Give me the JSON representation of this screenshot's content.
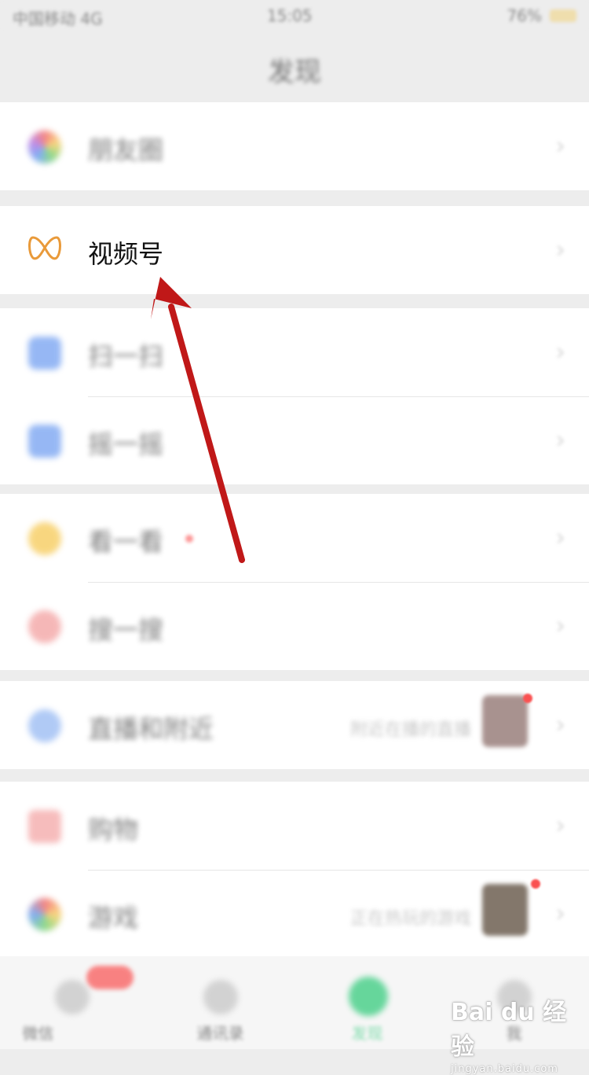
{
  "status_bar": {
    "carrier": "中国移动 4G",
    "time": "15:05",
    "battery": "76%"
  },
  "header": {
    "title": "发现"
  },
  "groups": [
    {
      "items": [
        {
          "label": "朋友圈",
          "icon": "moments-icon",
          "color": "#f0a040"
        }
      ]
    },
    {
      "items": [
        {
          "label": "视频号",
          "icon": "channels-icon",
          "color": "#e99a3a"
        }
      ]
    },
    {
      "items": [
        {
          "label": "扫一扫",
          "icon": "scan-icon",
          "color": "#5a8ee8"
        },
        {
          "label": "摇一摇",
          "icon": "shake-icon",
          "color": "#5a8ee8"
        }
      ]
    },
    {
      "items": [
        {
          "label": "看一看",
          "icon": "top-stories-icon",
          "color": "#f6c64a"
        },
        {
          "label": "搜一搜",
          "icon": "search-icon",
          "color": "#f06f6f"
        }
      ]
    },
    {
      "items": [
        {
          "label": "直播和附近",
          "icon": "nearby-icon",
          "color": "#5a8ee8",
          "subtext": "附近在播的直播"
        }
      ]
    },
    {
      "items": [
        {
          "label": "购物",
          "icon": "shopping-icon",
          "color": "#f06f6f"
        },
        {
          "label": "游戏",
          "icon": "games-icon",
          "color": "#5a8ee8",
          "subtext": "正在热玩的游戏"
        }
      ]
    }
  ],
  "tab_bar": {
    "tabs": [
      {
        "label": "微信"
      },
      {
        "label": "通讯录"
      },
      {
        "label": "发现"
      },
      {
        "label": "我"
      }
    ]
  },
  "watermark": {
    "brand": "Bai du 经验",
    "url": "jingyan.baidu.com"
  },
  "colors": {
    "accent_green": "#07c160",
    "arrow_red": "#c01818",
    "badge_red": "#fa5151"
  }
}
